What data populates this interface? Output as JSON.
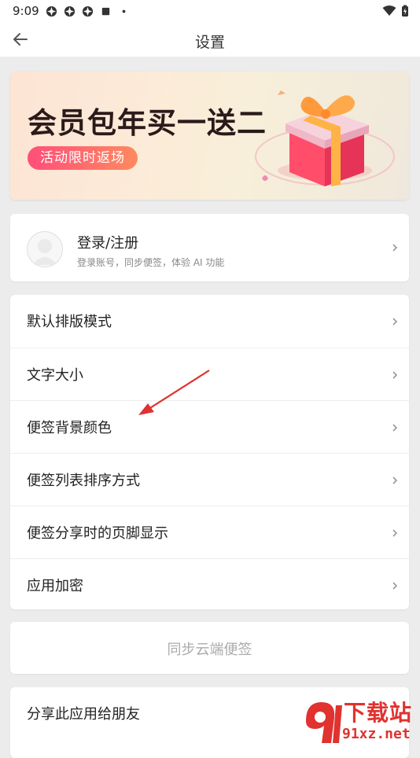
{
  "status_bar": {
    "time": "9:09",
    "battery_charging": true
  },
  "header": {
    "title": "设置"
  },
  "banner": {
    "title": "会员包年买一送二",
    "pill": "活动限时返场"
  },
  "login": {
    "title": "登录/注册",
    "subtitle": "登录账号，同步便签，体验 AI 功能"
  },
  "settings": {
    "items": [
      {
        "label": "默认排版模式"
      },
      {
        "label": "文字大小"
      },
      {
        "label": "便签背景颜色"
      },
      {
        "label": "便签列表排序方式"
      },
      {
        "label": "便签分享时的页脚显示"
      },
      {
        "label": "应用加密"
      }
    ]
  },
  "sync": {
    "label": "同步云端便签"
  },
  "share": {
    "label": "分享此应用给朋友"
  },
  "watermark": {
    "brand": "下载站",
    "url": "91xz.net"
  },
  "colors": {
    "accent_pink": "#ff4e7a",
    "annotation_red": "#e0322f",
    "page_bg": "#ececec"
  }
}
